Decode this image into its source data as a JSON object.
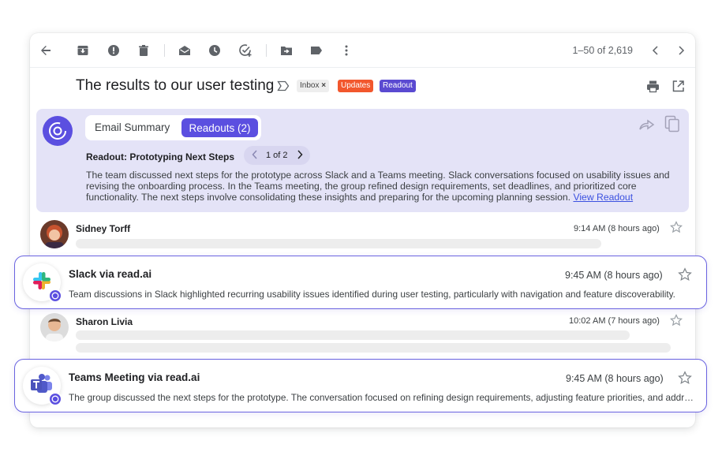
{
  "toolbar": {
    "icons": [
      "back-arrow-icon",
      "archive-icon",
      "report-spam-icon",
      "delete-icon",
      "mark-unread-icon",
      "snooze-icon",
      "add-task-icon",
      "move-to-icon",
      "label-icon",
      "more-icon"
    ],
    "pager_text": "1–50 of 2,619"
  },
  "email": {
    "subject": "The results to our user testing",
    "labels": {
      "inbox": "Inbox",
      "inbox_remove": "×",
      "updates": "Updates",
      "readout": "Readout"
    }
  },
  "readout": {
    "tab_summary": "Email Summary",
    "tab_readouts": "Readouts (2)",
    "title": "Readout: Prototyping Next Steps",
    "pager": "1 of 2",
    "body": "The team discussed next steps for the prototype across Slack and a Teams meeting. Slack conversations focused on usability issues and revising the onboarding process. In the Teams meeting, the group refined design requirements, set deadlines, and prioritized core functionality. The next steps involve consolidating these insights and preparing for the upcoming planning session.",
    "link": "View Readout",
    "colors": {
      "accent": "#5b4fe0",
      "panel": "#e4e3f7",
      "link": "#3b51e0"
    }
  },
  "messages": [
    {
      "sender": "Sidney Torff",
      "time": "9:14 AM",
      "ago": "(8 hours ago)"
    },
    {
      "sender": "Slack via read.ai",
      "time": "9:45 AM",
      "ago": "(8 hours ago)",
      "snippet": "Team discussions in Slack highlighted recurring usability issues identified during user testing, particularly with navigation and feature discoverability."
    },
    {
      "sender": "Sharon Livia",
      "time": "10:02 AM",
      "ago": "(7 hours ago)"
    },
    {
      "sender": "Teams Meeting via read.ai",
      "time": "9:45 AM",
      "ago": "(8 hours ago)",
      "snippet": "The group discussed the next steps for the prototype. The conversation focused on refining design requirements, adjusting feature priorities, and addressing open questions."
    }
  ]
}
